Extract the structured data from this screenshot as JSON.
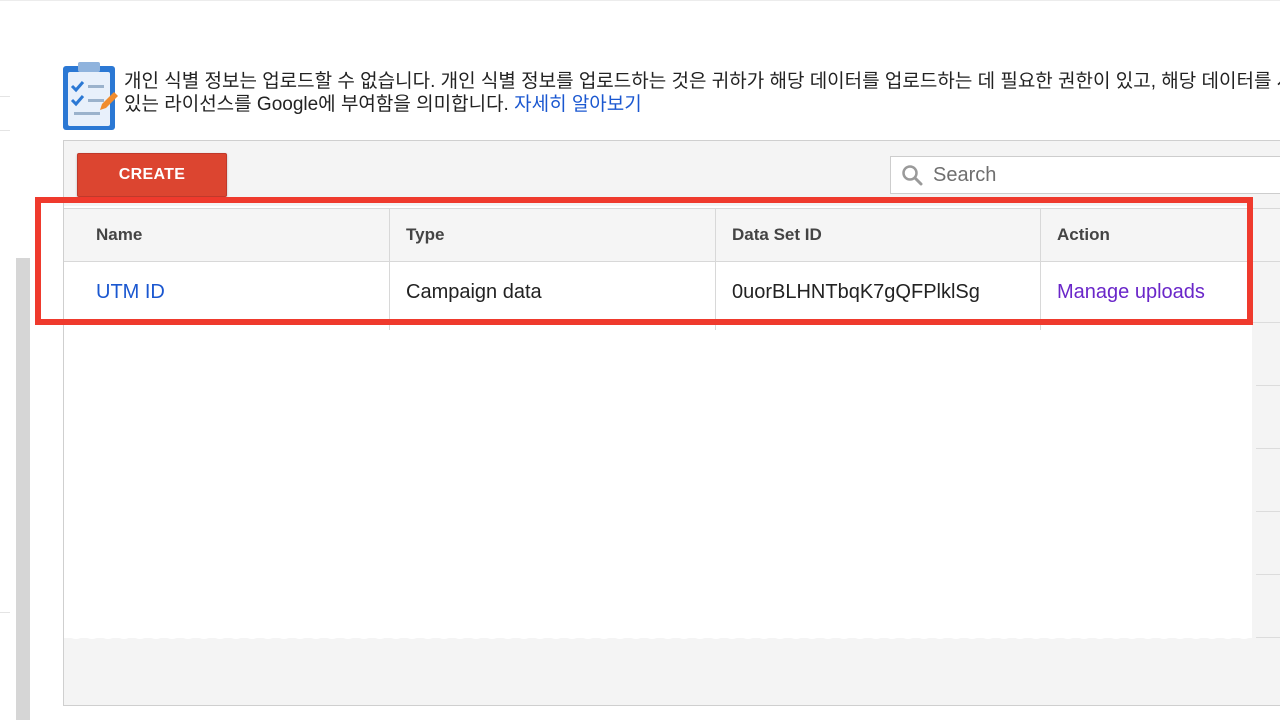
{
  "notice": {
    "line1": "개인 식별 정보는 업로드할 수 없습니다. 개인 식별 정보를 업로드하는 것은 귀하가 해당 데이터를 업로드하는 데 필요한 권한이 있고, 해당 데이터를 사",
    "line2_prefix": "있는 라이선스를 Google에 부여함을 의미합니다.",
    "learn_more": "자세히 알아보기",
    "icon": "checklist-icon"
  },
  "toolbar": {
    "create_label": "CREATE",
    "search_placeholder": "Search",
    "search_icon": "search-icon"
  },
  "table": {
    "headers": [
      "Name",
      "Type",
      "Data Set ID",
      "Action"
    ],
    "rows": [
      {
        "name": "UTM ID",
        "type": "Campaign data",
        "data_set_id": "0uorBLHNTbqK7gQFPlklSg",
        "action": "Manage uploads"
      }
    ]
  },
  "colors": {
    "create_button": "#dc4530",
    "highlight": "#ef3a2d",
    "link": "#1a57d0",
    "visited_link": "#6a26c9"
  }
}
